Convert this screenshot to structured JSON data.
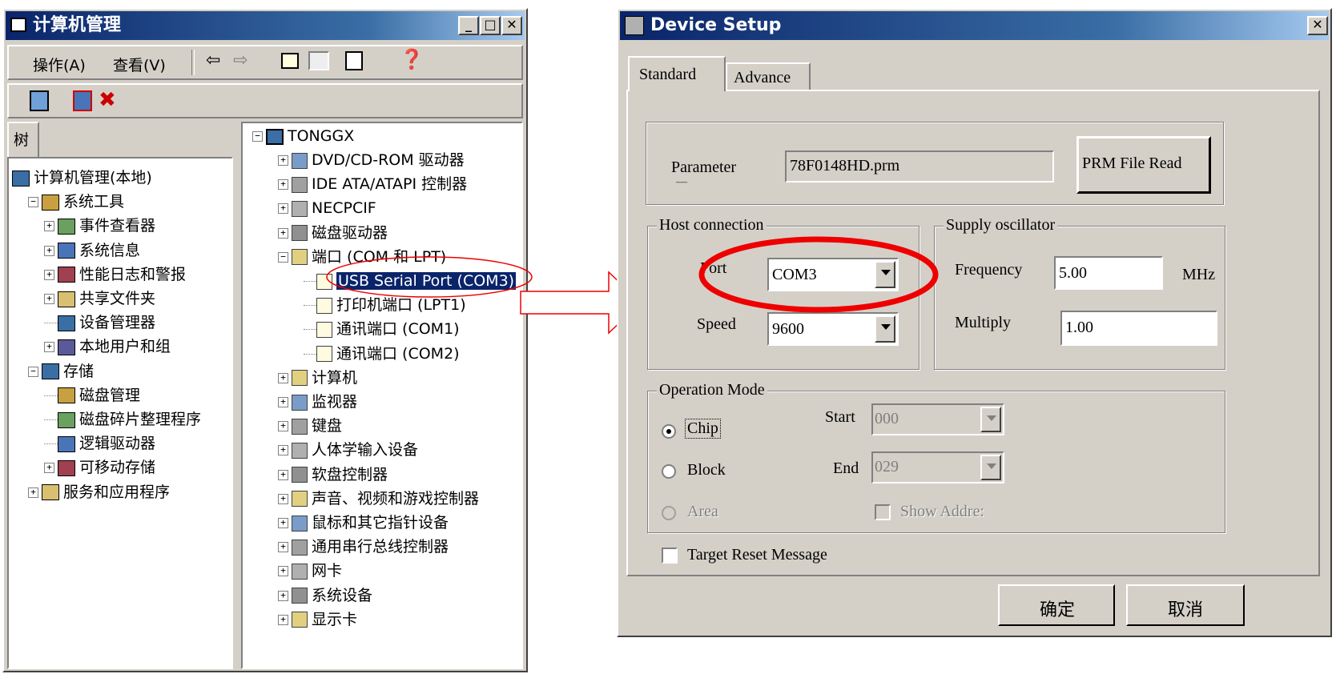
{
  "left_window": {
    "title": "计算机管理",
    "menu": [
      "操作(A)",
      "查看(V)"
    ],
    "tree_tab": "树",
    "tree": [
      {
        "label": "计算机管理(本地)",
        "indent": 0
      },
      {
        "label": "系统工具",
        "indent": 1,
        "expander": "-"
      },
      {
        "label": "事件查看器",
        "indent": 2,
        "expander": "+"
      },
      {
        "label": "系统信息",
        "indent": 2,
        "expander": "+"
      },
      {
        "label": "性能日志和警报",
        "indent": 2,
        "expander": "+"
      },
      {
        "label": "共享文件夹",
        "indent": 2,
        "expander": "+"
      },
      {
        "label": "设备管理器",
        "indent": 2,
        "expander": ""
      },
      {
        "label": "本地用户和组",
        "indent": 2,
        "expander": "+"
      },
      {
        "label": "存储",
        "indent": 1,
        "expander": "-"
      },
      {
        "label": "磁盘管理",
        "indent": 2,
        "expander": ""
      },
      {
        "label": "磁盘碎片整理程序",
        "indent": 2,
        "expander": ""
      },
      {
        "label": "逻辑驱动器",
        "indent": 2,
        "expander": ""
      },
      {
        "label": "可移动存储",
        "indent": 2,
        "expander": "+"
      },
      {
        "label": "服务和应用程序",
        "indent": 1,
        "expander": "+"
      }
    ],
    "devices": {
      "root": "TONGGX",
      "items": [
        {
          "label": "DVD/CD-ROM 驱动器",
          "indent": 1,
          "expander": "+"
        },
        {
          "label": "IDE ATA/ATAPI 控制器",
          "indent": 1,
          "expander": "+"
        },
        {
          "label": "NECPCIF",
          "indent": 1,
          "expander": "+"
        },
        {
          "label": "磁盘驱动器",
          "indent": 1,
          "expander": "+"
        },
        {
          "label": "端口 (COM 和 LPT)",
          "indent": 1,
          "expander": "-"
        },
        {
          "label": "USB Serial Port (COM3)",
          "indent": 2,
          "expander": "",
          "selected": true
        },
        {
          "label": "打印机端口 (LPT1)",
          "indent": 2,
          "expander": ""
        },
        {
          "label": "通讯端口 (COM1)",
          "indent": 2,
          "expander": ""
        },
        {
          "label": "通讯端口 (COM2)",
          "indent": 2,
          "expander": ""
        },
        {
          "label": "计算机",
          "indent": 1,
          "expander": "+"
        },
        {
          "label": "监视器",
          "indent": 1,
          "expander": "+"
        },
        {
          "label": "键盘",
          "indent": 1,
          "expander": "+"
        },
        {
          "label": "人体学输入设备",
          "indent": 1,
          "expander": "+"
        },
        {
          "label": "软盘控制器",
          "indent": 1,
          "expander": "+"
        },
        {
          "label": "声音、视频和游戏控制器",
          "indent": 1,
          "expander": "+"
        },
        {
          "label": "鼠标和其它指针设备",
          "indent": 1,
          "expander": "+"
        },
        {
          "label": "通用串行总线控制器",
          "indent": 1,
          "expander": "+"
        },
        {
          "label": "网卡",
          "indent": 1,
          "expander": "+"
        },
        {
          "label": "系统设备",
          "indent": 1,
          "expander": "+"
        },
        {
          "label": "显示卡",
          "indent": 1,
          "expander": "+"
        }
      ]
    }
  },
  "dialog": {
    "title": "Device Setup",
    "tabs": [
      "Standard",
      "Advance"
    ],
    "parameter_label": "Parameter",
    "parameter_label_cut": "—",
    "parameter_value": "78F0148HD.prm",
    "prm_button": "PRM File Read",
    "host_group": "Host connection",
    "port_label": "Port",
    "port_value": "COM3",
    "speed_label": "Speed",
    "speed_value": "9600",
    "supply_group": "Supply oscillator",
    "frequency_label": "Frequency",
    "frequency_value": "5.00",
    "frequency_unit": "MHz",
    "multiply_label": "Multiply",
    "multiply_value": "1.00",
    "op_group": "Operation Mode",
    "chip_label": "Chip",
    "block_label": "Block",
    "area_label": "Area",
    "start_label": "Start",
    "start_value": "000",
    "end_label": "End",
    "end_value": "029",
    "show_address_label": "Show Addre:",
    "target_reset_label": "Target Reset Message",
    "ok_label": "确定",
    "cancel_label": "取消"
  },
  "colors": {
    "highlight": "#0a246a",
    "annotation": "#ff0000",
    "face": "#d4d0c8"
  }
}
